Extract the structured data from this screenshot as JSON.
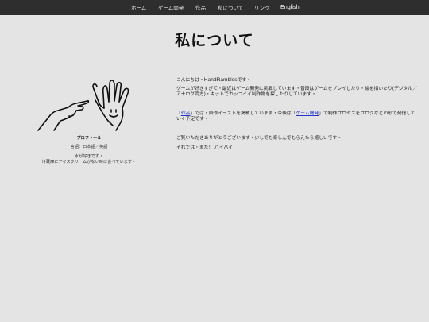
{
  "nav": {
    "home": "ホーム",
    "game_dev": "ゲーム開発",
    "works": "作品",
    "about": "私について",
    "links": "リンク",
    "english": "English"
  },
  "page": {
    "title": "私について"
  },
  "profile": {
    "label": "プロフィール",
    "languages": "言語：日本語／英語",
    "note_line1": "水が好きです・",
    "note_line2": "冷蔵庫にアイスクリームがない時に食べています・"
  },
  "content": {
    "greeting_prefix": "こんにちは・",
    "name": "HandRambles",
    "greeting_suffix": "です・",
    "para2": "ゲームが好きすぎて・最近はゲーム開発に挑戦しています・普段はゲームをプレイしたり・絵を描いたり(デジタル／アナログ両方)・キットでカッコイイ制作物を探したりしています・",
    "para3_open": "「",
    "works_link": "作品",
    "para3_mid": "」では・自作イラストを掲載しています・今後は「",
    "gamedev_link": "ゲーム開発",
    "para3_end": "」で制作プロセスをブログなどの形で発信していく予定です・",
    "para4": "ご覧いただきありがとうございます・少しでも楽しんでもらえたら嬉しいです・",
    "para5": "それでは・また！ バイバイ！"
  }
}
